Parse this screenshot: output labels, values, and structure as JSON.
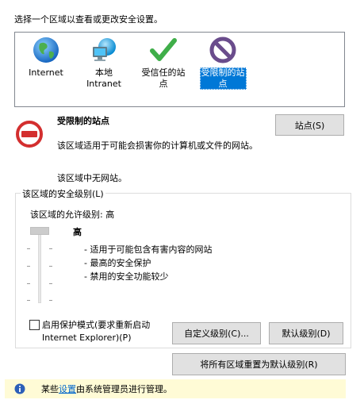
{
  "header": {
    "instruction": "选择一个区域以查看或更改安全设置。"
  },
  "zones": [
    {
      "label": "Internet",
      "icon": "globe-icon"
    },
    {
      "label": "本地\nIntranet",
      "icon": "network-computer-icon"
    },
    {
      "label": "受信任的站\n点",
      "icon": "checkmark-icon"
    },
    {
      "label": "受限制的站\n点",
      "icon": "restricted-icon",
      "selected": true
    }
  ],
  "zone_info": {
    "title": "受限制的站点",
    "description": "该区域适用于可能会损害你的计算机或文件的网站。",
    "status": "该区域中无网站。",
    "sites_button": "站点(S)"
  },
  "security_level": {
    "group_label": "该区域的安全级别(L)",
    "allowed_level": "该区域的允许级别: 高",
    "level_name": "高",
    "bullets": [
      "- 适用于可能包含有害内容的网站",
      "- 最高的安全保护",
      "- 禁用的安全功能较少"
    ],
    "slider_position": "highest",
    "protected_mode_label_1": "启用保护模式(要求重新启动",
    "protected_mode_label_2": "Internet Explorer)(P)",
    "protected_mode_checked": false,
    "custom_level_button": "自定义级别(C)...",
    "default_level_button": "默认级别(D)"
  },
  "reset_all_button": "将所有区域重置为默认级别(R)",
  "admin_notice": {
    "prefix": "某些",
    "link": "设置",
    "suffix": "由系统管理员进行管理。"
  },
  "colors": {
    "selection": "#0078d7",
    "info_bar_bg": "#fffbd6",
    "link": "#0066cc",
    "restricted_red": "#d32f2f"
  }
}
